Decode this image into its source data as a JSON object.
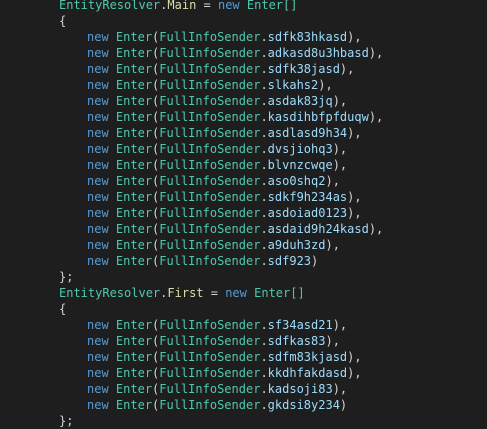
{
  "code": {
    "blocks": [
      {
        "class": "EntityResolver",
        "field": "Main",
        "new_kw": "new",
        "type_decl": "Enter[]",
        "items": [
          "sdfk83hkasd",
          "adkasd8u3hbasd",
          "sdfk38jasd",
          "slkahs2",
          "asdak83jq",
          "kasdihbfpfduqw",
          "asdlasd9h34",
          "dvsjiohq3",
          "blvnzcwqe",
          "aso0shq2",
          "sdkf9h234as",
          "asdoiad0123",
          "asdaid9h24kasd",
          "a9duh3zd",
          "sdf923"
        ]
      },
      {
        "class": "EntityResolver",
        "field": "First",
        "new_kw": "new",
        "type_decl": "Enter[]",
        "items": [
          "sf34asd21",
          "sdfkas83",
          "sdfm83kjasd",
          "kkdhfakdasd",
          "kadsoji83",
          "gkdsi8y234"
        ]
      }
    ],
    "item_new_kw": "new",
    "item_type": "Enter",
    "sender_class": "FullInfoSender",
    "open_brace": "{",
    "close_brace": "};"
  },
  "colors": {
    "background": "#1e1e1e",
    "class": "#4ec9b0",
    "field": "#dcdcaa",
    "keyword": "#569cd6",
    "member": "#9cdcfe",
    "punctuation": "#d4d4d4"
  }
}
